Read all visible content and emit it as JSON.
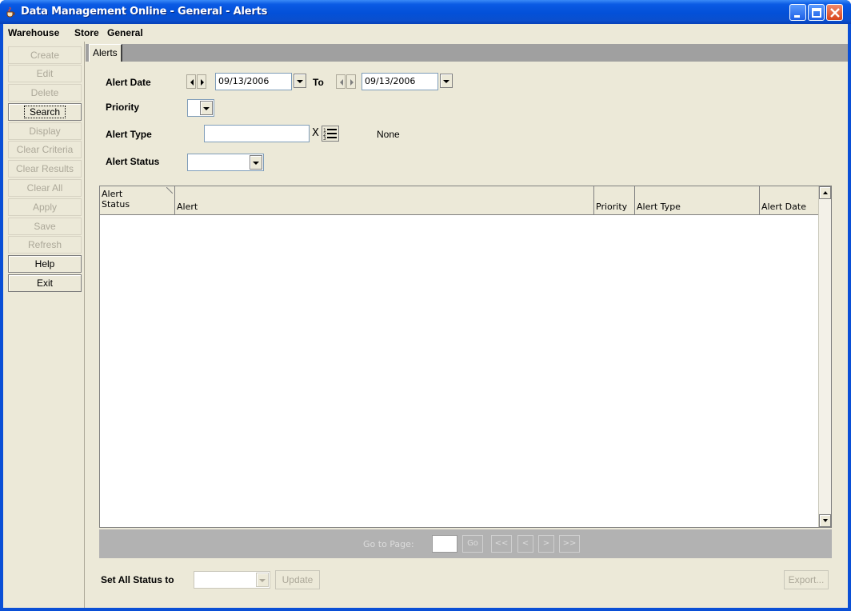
{
  "window": {
    "title": "Data Management Online - General - Alerts"
  },
  "menu": {
    "items": [
      "Warehouse",
      "Store",
      "General"
    ]
  },
  "actions": {
    "buttons": [
      {
        "label": "Create",
        "enabled": false
      },
      {
        "label": "Edit",
        "enabled": false
      },
      {
        "label": "Delete",
        "enabled": false
      },
      {
        "label": "Search",
        "enabled": true
      },
      {
        "label": "Display",
        "enabled": false
      },
      {
        "label": "Clear Criteria",
        "enabled": false
      },
      {
        "label": "Clear Results",
        "enabled": false
      },
      {
        "label": "Clear All",
        "enabled": false
      },
      {
        "label": "Apply",
        "enabled": false
      },
      {
        "label": "Save",
        "enabled": false
      },
      {
        "label": "Refresh",
        "enabled": false
      },
      {
        "label": "Help",
        "enabled": true
      },
      {
        "label": "Exit",
        "enabled": true
      }
    ]
  },
  "tabs": [
    {
      "label": "Alerts"
    }
  ],
  "criteria": {
    "alert_date_label": "Alert Date",
    "date_from": "09/13/2006",
    "to_label": "To",
    "date_to": "09/13/2006",
    "priority_label": "Priority",
    "priority_value": "",
    "alert_type_label": "Alert Type",
    "alert_type_value": "",
    "alert_type_clear": "X",
    "alert_type_description": "None",
    "alert_status_label": "Alert Status",
    "alert_status_value": ""
  },
  "grid": {
    "columns": [
      {
        "line1": "Alert",
        "line2": "Status"
      },
      {
        "line1": "",
        "line2": "Alert"
      },
      {
        "line1": "",
        "line2": "Priority"
      },
      {
        "line1": "",
        "line2": "Alert Type"
      },
      {
        "line1": "",
        "line2": "Alert Date"
      }
    ],
    "rows": []
  },
  "pager": {
    "label": "Go to Page:",
    "page_value": "",
    "go": "Go",
    "first": "<<",
    "prev": "<",
    "next": ">",
    "last": ">>"
  },
  "footer": {
    "set_all_label": "Set All Status to",
    "status_value": "",
    "update": "Update",
    "export": "Export..."
  },
  "colors": {
    "titlebar": "#0a5ae4",
    "client": "#ece9d8",
    "pager": "#b2b2b2"
  }
}
